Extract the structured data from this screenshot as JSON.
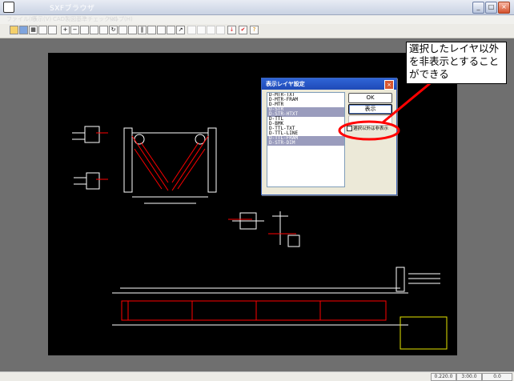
{
  "window": {
    "title": "SXFブラウザ",
    "controls": {
      "minimize": "_",
      "maximize": "□",
      "close": "×"
    }
  },
  "menu": [
    "ファイル(F)",
    "表示(V)",
    "CAD製図基準チェック(K)",
    "ヘルプ(H)"
  ],
  "toolbar": {
    "icons": [
      "folder-icon",
      "save-icon",
      "grid-icon",
      "print-icon",
      "layers-icon",
      "zoom-in-icon",
      "zoom-out-icon",
      "zoom-fit-icon",
      "zoom-window-icon",
      "pan-icon",
      "rotate-icon",
      "measure-icon",
      "properties-icon",
      "columns-icon",
      "draw-icon",
      "layer-icon",
      "arrow-icon",
      "window-icon",
      "window-icon",
      "window-icon",
      "window-icon",
      "check-icon",
      "check-icon",
      "help-icon"
    ]
  },
  "dialog": {
    "title": "表示レイヤ設定",
    "layers": [
      {
        "name": "D-MTR-TXT",
        "selected": false
      },
      {
        "name": "D-MTR-FRAM",
        "selected": false
      },
      {
        "name": "D-MTR",
        "selected": false
      },
      {
        "name": "D-STR",
        "selected": true
      },
      {
        "name": "D-STR-HTXT",
        "selected": true
      },
      {
        "name": "D-TTL",
        "selected": false
      },
      {
        "name": "D-BMK",
        "selected": false
      },
      {
        "name": "D-TTL-TXT",
        "selected": false
      },
      {
        "name": "D-TTL-LINE",
        "selected": false
      },
      {
        "name": "D-TTL-FRAM",
        "selected": true
      },
      {
        "name": "D-STR-DIM",
        "selected": true
      }
    ],
    "ok_label": "OK",
    "show_label": "表示",
    "checkbox_label": "選択以外は非表示",
    "checkbox_checked": true
  },
  "callout": {
    "lines": [
      "選択したレイヤ以外",
      "を非表示とすること",
      "ができる"
    ]
  },
  "status": [
    "0.220.0",
    "3:00.0",
    "0.0"
  ],
  "colors": {
    "canvas": "#000000",
    "highlight": "#ff0000",
    "title_bar": "#1f4ab7"
  }
}
